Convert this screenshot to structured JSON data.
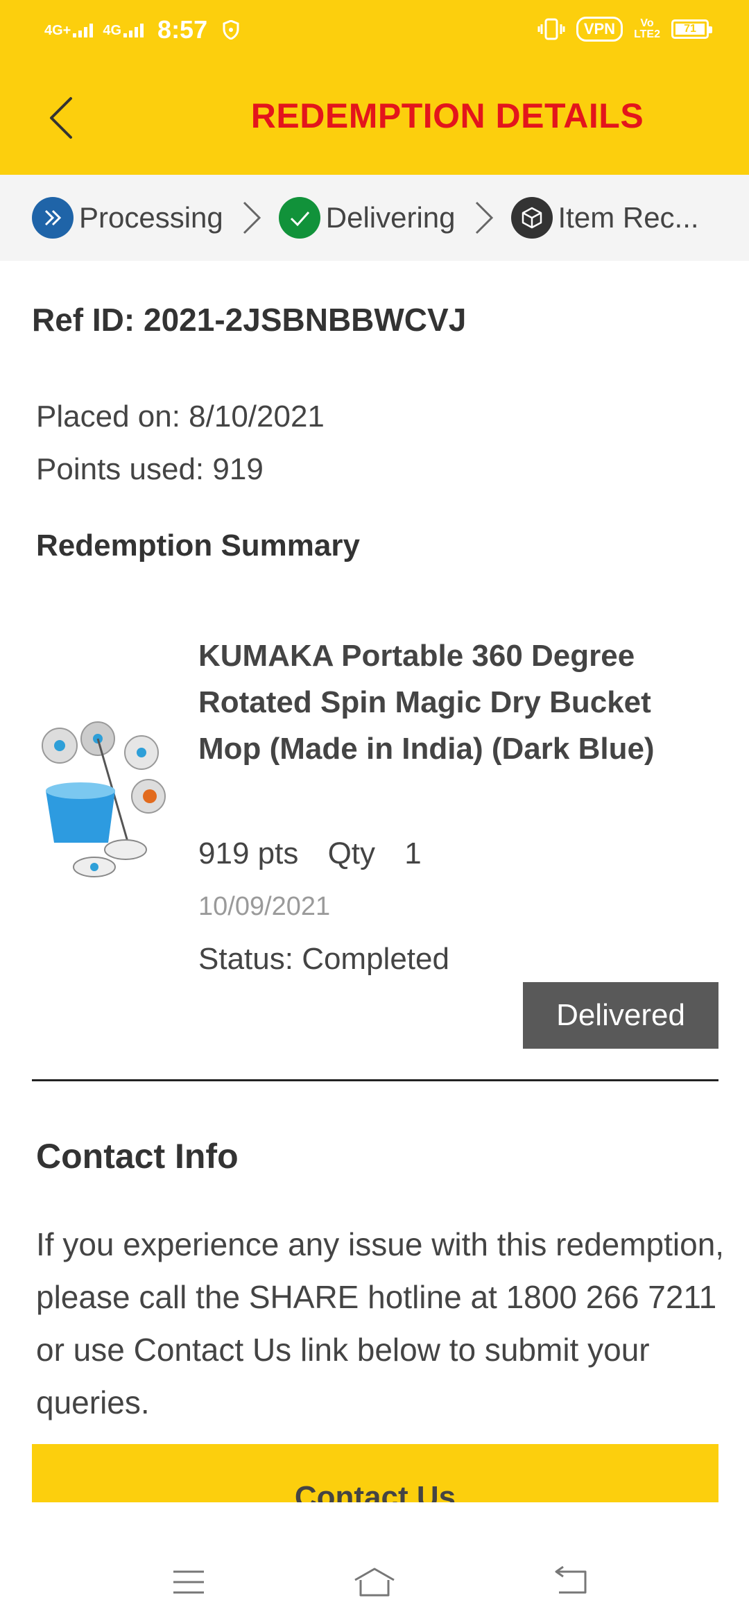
{
  "status_bar": {
    "network_1": "4G+",
    "network_2": "4G",
    "time": "8:57",
    "vpn": "VPN",
    "volte_1": "Vo",
    "volte_2": "LTE2",
    "battery": "71"
  },
  "header": {
    "title": "REDEMPTION DETAILS"
  },
  "steps": [
    {
      "label": "Processing",
      "color": "#1F64A8"
    },
    {
      "label": "Delivering",
      "color": "#11923A"
    },
    {
      "label": "Item Rec...",
      "color": "#333333"
    }
  ],
  "order": {
    "ref_id": "Ref ID: 2021-2JSBNBBWCVJ",
    "placed_on": "Placed on: 8/10/2021",
    "points_used": "Points used: 919"
  },
  "summary": {
    "title": "Redemption Summary",
    "item": {
      "name": "KUMAKA Portable 360 Degree Rotated Spin Magic Dry Bucket Mop (Made in India) (Dark Blue)",
      "points": "919 pts",
      "qty_label": "Qty",
      "qty": "1",
      "date": "10/09/2021",
      "status": "Status: Completed",
      "badge": "Delivered"
    }
  },
  "contact": {
    "title": "Contact Info",
    "text": "If you experience any issue with this redemption, please call the SHARE hotline at 1800 266 7211 or use Contact Us link below to submit your queries.",
    "button": "Contact Us"
  },
  "nav": {
    "icons": [
      "menu-icon",
      "home-icon",
      "back-icon"
    ]
  },
  "colors": {
    "header_bg": "#FCCF0D",
    "title": "#E3151C",
    "badge_bg": "#595959"
  }
}
